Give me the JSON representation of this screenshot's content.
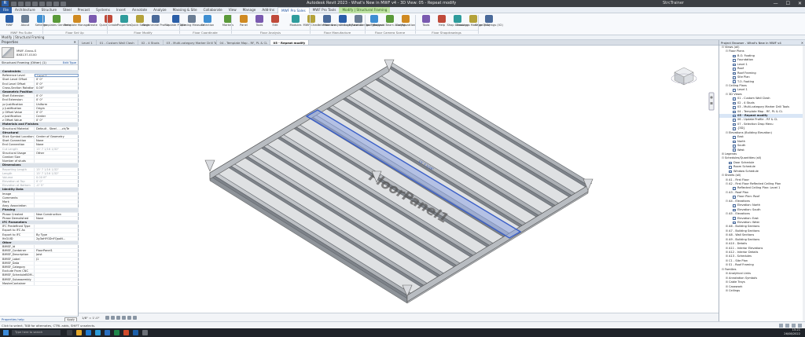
{
  "window": {
    "title": "Autodesk Revit 2023 - What's New in MWF v4 - 3D View: 05 - Repeat modify",
    "user": "StrcTrainer",
    "controls": [
      "—",
      "☐",
      "✕"
    ],
    "logo": "R"
  },
  "ribbon_tabs": [
    "File",
    "Architecture",
    "Structure",
    "Steel",
    "Precast",
    "Systems",
    "Insert",
    "Annotate",
    "Analyze",
    "Massing & Site",
    "Collaborate",
    "View",
    "Manage",
    "Add-Ins",
    "MWF Pro Sales",
    "MWF Pro Tools",
    "Modify | Structural Framing"
  ],
  "ribbon": {
    "buttons": [
      "MWF",
      "About",
      "Settings",
      "Templates Generate",
      "Template Manager",
      "Create",
      "Quick Create",
      "Properties",
      "Quick Search",
      "Regenerate Profile",
      "Update Profile",
      "Opening Measure",
      "Selection",
      "Markers",
      "Panel",
      "Tools",
      "Edit",
      "Modules",
      "MWF Check",
      "Interference",
      "Floor Analysis Configuration",
      "Change Panel Design Type",
      "Floor Analysis",
      "Support Beam Analysis",
      "Configuration",
      "Tools",
      "Help",
      "Shop Drawings",
      "Drawings Manager (V2)",
      "Shop Drawings (V2)"
    ],
    "panels": [
      "MWF Pro Suite",
      "Floor Set Up",
      "Floor Modify",
      "Floor Coordinate",
      "Floor Analysis",
      "Floor Manufacture",
      "Floor Camera Scene",
      "Floor Shopdrawings"
    ]
  },
  "options_bar": "Modify | Structural Framing",
  "properties": {
    "header": "Properties",
    "type_name": "MWF-Gross-S",
    "type_sub": "8X8137-0100",
    "instance_selector": "Structural Framing (Other) (1)",
    "edit_type": "Edit Type",
    "rows": [
      {
        "k": "Constraints",
        "v": "",
        "g": true
      },
      {
        "k": "Reference Level",
        "v": "Level 1",
        "e": true
      },
      {
        "k": "Start Level Offset",
        "v": "0' 0\""
      },
      {
        "k": "End Level Offset",
        "v": "0' 0\""
      },
      {
        "k": "Cross-Section Rotation",
        "v": "0.00°"
      },
      {
        "k": "Geometric Position",
        "v": "",
        "g": true
      },
      {
        "k": "Start Extension",
        "v": "0' 0\""
      },
      {
        "k": "End Extension",
        "v": "0' 0\""
      },
      {
        "k": "yz Justification",
        "v": "Uniform"
      },
      {
        "k": "y Justification",
        "v": "Origin"
      },
      {
        "k": "y Offset Value",
        "v": "0' 0\""
      },
      {
        "k": "z Justification",
        "v": "Center"
      },
      {
        "k": "z Offset Value",
        "v": "0' 0\""
      },
      {
        "k": "Materials and Finishes",
        "v": "",
        "g": true
      },
      {
        "k": "Structural Material",
        "v": "Default - Steel - ...ch/Te"
      },
      {
        "k": "Structural",
        "v": "",
        "g": true
      },
      {
        "k": "Stick Symbol Location",
        "v": "Center of Geometry"
      },
      {
        "k": "Start Connection",
        "v": "None"
      },
      {
        "k": "End Connection",
        "v": "None"
      },
      {
        "k": "Cut Length",
        "v": "13' 7 1/16 1/32\"",
        "d": true
      },
      {
        "k": "Structural Usage",
        "v": "Other"
      },
      {
        "k": "Camber Size",
        "v": ""
      },
      {
        "k": "Number of studs",
        "v": ""
      },
      {
        "k": "Dimensions",
        "v": "",
        "g": true
      },
      {
        "k": "Reporting Length",
        "v": "13' 7 1/16 1/32\"",
        "d": true
      },
      {
        "k": "Length",
        "v": "13' 7 1/16 1/32\"",
        "d": true
      },
      {
        "k": "Volume",
        "v": "0.00 ft³",
        "d": true
      },
      {
        "k": "Elevation at Top",
        "v": "0' 0\"",
        "d": true
      },
      {
        "k": "Elevation at Bottom",
        "v": "-0' 5\"",
        "d": true
      },
      {
        "k": "Identity Data",
        "v": "",
        "g": true
      },
      {
        "k": "Image",
        "v": ""
      },
      {
        "k": "Comments",
        "v": ""
      },
      {
        "k": "Mark",
        "v": ""
      },
      {
        "k": "Assy. Association",
        "v": ""
      },
      {
        "k": "Phasing",
        "v": "",
        "g": true
      },
      {
        "k": "Phase Created",
        "v": "New Construction"
      },
      {
        "k": "Phase Demolished",
        "v": "None"
      },
      {
        "k": "IFC Parameters",
        "v": "",
        "g": true
      },
      {
        "k": "IFC Predefined Type",
        "v": ""
      },
      {
        "k": "Export to IFC As",
        "v": ""
      },
      {
        "k": "Export to IFC",
        "v": "By Type"
      },
      {
        "k": "IfcGUID",
        "v": "2g3aHYGDnFQpoN..."
      },
      {
        "k": "Other",
        "v": "",
        "g": true
      },
      {
        "k": "BIMSF_Id",
        "v": ""
      },
      {
        "k": "BIMSF_Container",
        "v": "FloorPanel1"
      },
      {
        "k": "BIMSF_Description",
        "v": "Joist"
      },
      {
        "k": "BIMSF_Label",
        "v": "J1"
      },
      {
        "k": "BIMSF_Data",
        "v": ""
      },
      {
        "k": "BIMSF_Category",
        "v": ""
      },
      {
        "k": "Exclude From CNC",
        "v": ""
      },
      {
        "k": "BIMSF_ScheduleBOM...",
        "v": ""
      },
      {
        "k": "BIMSF_Subassembly",
        "v": ""
      },
      {
        "k": "MasterContainer",
        "v": ""
      }
    ],
    "help_link": "Properties help",
    "apply": "Apply"
  },
  "view_tabs": [
    "Level 1",
    "01 - Custom Wall Clash",
    "02 - 4 Studs",
    "03 - Multi-category Marker Drill Tools",
    "04 - Template Map - RF, PL & CL",
    "05 - Repeat modify"
  ],
  "canvas": {
    "panel_label": "FloorPanel1",
    "scale": "1/8\" = 1'-0\"",
    "dim_label": "13' 7 1/16\""
  },
  "browser": {
    "header": "Project Browser - What's New in MWF v4",
    "items": [
      {
        "t": "Views (all)",
        "l": 0,
        "tg": "⊟"
      },
      {
        "t": "Floor Plans",
        "l": 1,
        "tg": "⊟"
      },
      {
        "t": "B.O. Footing",
        "l": 2,
        "v": true
      },
      {
        "t": "Foundation",
        "l": 2,
        "v": true
      },
      {
        "t": "Level 1",
        "l": 2,
        "v": true
      },
      {
        "t": "Roof",
        "l": 2,
        "v": true
      },
      {
        "t": "Roof Framing",
        "l": 2,
        "v": true
      },
      {
        "t": "Site Plan",
        "l": 2,
        "v": true
      },
      {
        "t": "T.O. Footing",
        "l": 2,
        "v": true
      },
      {
        "t": "Ceiling Plans",
        "l": 1,
        "tg": "⊟"
      },
      {
        "t": "Level 1",
        "l": 2,
        "v": true
      },
      {
        "t": "3D Views",
        "l": 1,
        "tg": "⊟"
      },
      {
        "t": "01 - Custom Wall Clash",
        "l": 2,
        "v": true
      },
      {
        "t": "02 - 4 Studs",
        "l": 2,
        "v": true
      },
      {
        "t": "03 - Multi-category Marker Drill Tools",
        "l": 2,
        "v": true
      },
      {
        "t": "04 - Template Map - RF, PL & CL",
        "l": 2,
        "v": true
      },
      {
        "t": "05 - Repeat modify",
        "l": 2,
        "v": true,
        "b": true,
        "s": true
      },
      {
        "t": "06 - Update Profile - RF & CL",
        "l": 2,
        "v": true
      },
      {
        "t": "07 - Selection Drop Menu",
        "l": 2,
        "v": true
      },
      {
        "t": "{3D}",
        "l": 2,
        "v": true
      },
      {
        "t": "Elevations (Building Elevation)",
        "l": 1,
        "tg": "⊟"
      },
      {
        "t": "East",
        "l": 2,
        "v": true
      },
      {
        "t": "North",
        "l": 2,
        "v": true
      },
      {
        "t": "South",
        "l": 2,
        "v": true
      },
      {
        "t": "West",
        "l": 2,
        "v": true
      },
      {
        "t": "Legends",
        "l": 0,
        "tg": "⊞"
      },
      {
        "t": "Schedules/Quantities (all)",
        "l": 0,
        "tg": "⊟"
      },
      {
        "t": "Door Schedule",
        "l": 1,
        "v": true
      },
      {
        "t": "Room Schedule",
        "l": 1,
        "v": true
      },
      {
        "t": "Window Schedule",
        "l": 1,
        "v": true
      },
      {
        "t": "Sheets (all)",
        "l": 0,
        "tg": "⊟"
      },
      {
        "t": "A1 - First Floor",
        "l": 1,
        "tg": "⊞"
      },
      {
        "t": "A2 - First Floor Reflected Ceiling Plan",
        "l": 1,
        "tg": "⊟"
      },
      {
        "t": "Reflected Ceiling Plan: Level 1",
        "l": 2,
        "v": true
      },
      {
        "t": "A3 - Roof Plan",
        "l": 1,
        "tg": "⊟"
      },
      {
        "t": "Floor Plan: Roof",
        "l": 2,
        "v": true
      },
      {
        "t": "A4 - Elevations",
        "l": 1,
        "tg": "⊟"
      },
      {
        "t": "Elevation: North",
        "l": 2,
        "v": true
      },
      {
        "t": "Elevation: South",
        "l": 2,
        "v": true
      },
      {
        "t": "A5 - Elevations",
        "l": 1,
        "tg": "⊟"
      },
      {
        "t": "Elevation: East",
        "l": 2,
        "v": true
      },
      {
        "t": "Elevation: West",
        "l": 2,
        "v": true
      },
      {
        "t": "A6 - Building Sections",
        "l": 1,
        "tg": "⊞"
      },
      {
        "t": "A7 - Building Sections",
        "l": 1,
        "tg": "⊞"
      },
      {
        "t": "A8 - Wall Sections",
        "l": 1,
        "tg": "⊞"
      },
      {
        "t": "A9 - Building Sections",
        "l": 1,
        "tg": "⊞"
      },
      {
        "t": "A10 - Details",
        "l": 1,
        "tg": "⊞"
      },
      {
        "t": "A11 - Interior Elevations",
        "l": 1,
        "tg": "⊞"
      },
      {
        "t": "A12 - Interior Details",
        "l": 1,
        "tg": "⊞"
      },
      {
        "t": "A13 - Schedules",
        "l": 1,
        "tg": "⊞"
      },
      {
        "t": "C1 - Site Plan",
        "l": 1,
        "tg": "⊞"
      },
      {
        "t": "S1 - Roof Framing",
        "l": 1,
        "tg": "⊞"
      },
      {
        "t": "Families",
        "l": 0,
        "tg": "⊟"
      },
      {
        "t": "Analytical Links",
        "l": 1,
        "tg": "⊞"
      },
      {
        "t": "Annotation Symbols",
        "l": 1,
        "tg": "⊞"
      },
      {
        "t": "Cable Trays",
        "l": 1,
        "tg": "⊞"
      },
      {
        "t": "Casework",
        "l": 1,
        "tg": "⊞"
      },
      {
        "t": "Ceilings",
        "l": 1,
        "tg": "⊞"
      }
    ]
  },
  "status": "Click to select, TAB for alternates, CTRL adds, SHIFT unselects.",
  "taskbar": {
    "search": "Type here to search",
    "time": "15:21",
    "date": "26/08/2022"
  },
  "colors": {
    "selection": "#3a5fc8",
    "ribbon_accent": "#2a5ea8",
    "context_tab": "#bfe3a4"
  }
}
